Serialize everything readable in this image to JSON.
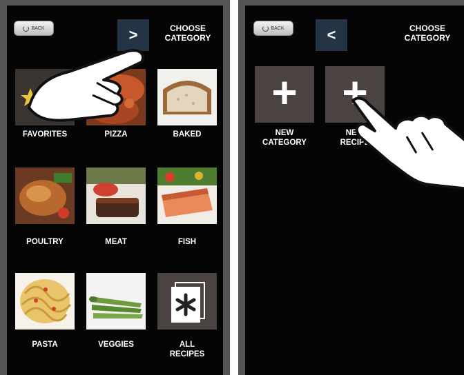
{
  "left_screen": {
    "back_label": "BACK",
    "nav_symbol": ">",
    "title_line1": "CHOOSE",
    "title_line2": "CATEGORY",
    "categories": [
      {
        "label": "FAVORITES",
        "icon": "star-icon"
      },
      {
        "label": "PIZZA",
        "icon": "pizza-photo"
      },
      {
        "label": "BAKED",
        "icon": "bread-photo"
      },
      {
        "label": "POULTRY",
        "icon": "chicken-photo"
      },
      {
        "label": "MEAT",
        "icon": "steak-photo"
      },
      {
        "label": "FISH",
        "icon": "salmon-photo"
      },
      {
        "label": "PASTA",
        "icon": "pasta-photo"
      },
      {
        "label": "VEGGIES",
        "icon": "asparagus-photo"
      },
      {
        "label_line1": "ALL",
        "label_line2": "RECIPES",
        "icon": "asterisk-icon"
      }
    ]
  },
  "right_screen": {
    "back_label": "BACK",
    "nav_symbol": "<",
    "title_line1": "CHOOSE",
    "title_line2": "CATEGORY",
    "new_category": {
      "line1": "NEW",
      "line2": "CATEGORY",
      "symbol": "+"
    },
    "new_recipe": {
      "line1": "NEW",
      "line2": "RECIPE",
      "symbol": "+"
    }
  },
  "colors": {
    "screen_bg": "#050505",
    "bezel": "#555555",
    "nav_button": "#243444",
    "plus_tile": "#4a4341"
  }
}
